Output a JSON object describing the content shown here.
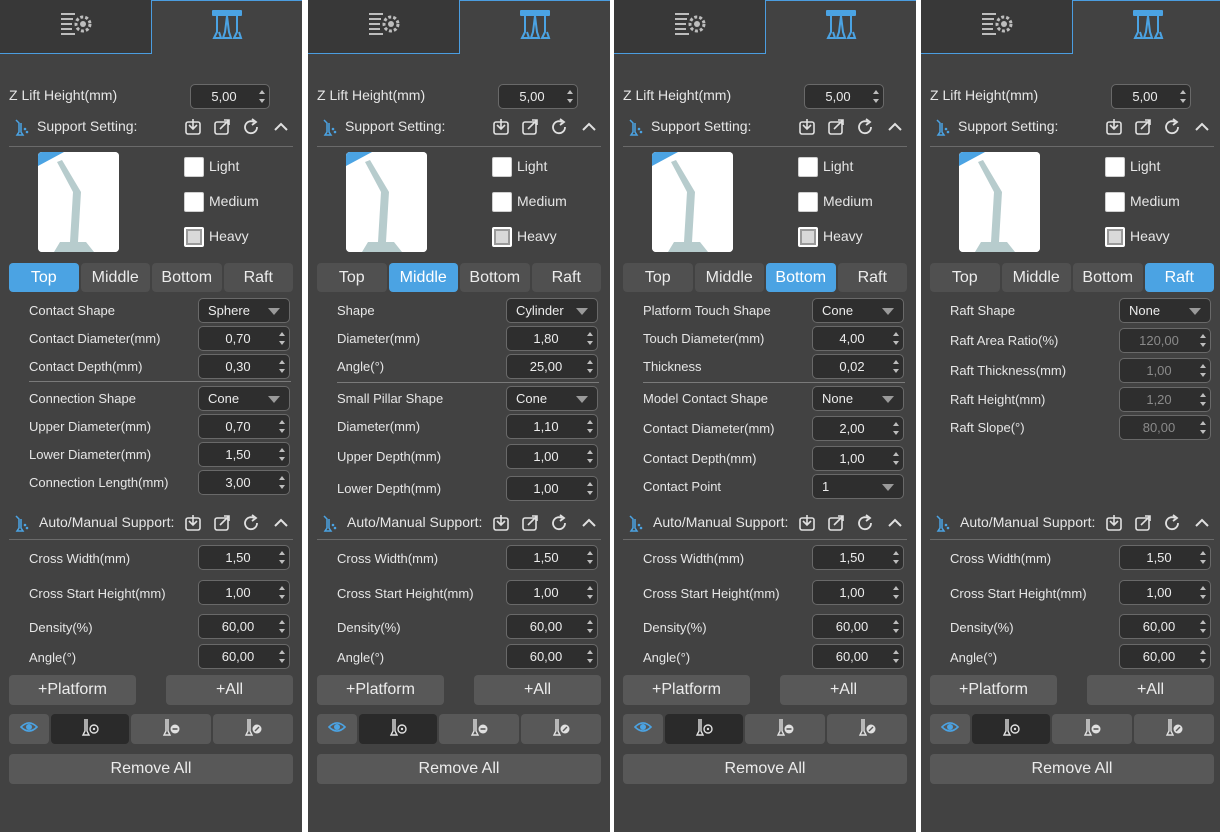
{
  "colors": {
    "accent": "#4ba3e3",
    "panel_bg": "#424242",
    "field_bg": "#2e2e2e"
  },
  "icons": {
    "tab_settings": "list-gear-icon",
    "tab_support": "support-pillars-icon",
    "section": "support-small-icon",
    "import": "import-icon",
    "export": "export-icon",
    "reset": "refresh-icon",
    "collapse": "chevron-up-icon",
    "eye": "eye-icon",
    "add_point": "support-add-icon",
    "remove_point": "support-remove-icon",
    "edit_point": "support-edit-icon"
  },
  "common": {
    "z_lift_label": "Z Lift Height(mm)",
    "z_lift_value": "5,00",
    "support_setting_label": "Support Setting:",
    "presets": [
      "Light",
      "Medium",
      "Heavy"
    ],
    "selected_preset": "Heavy",
    "tabs": [
      "Top",
      "Middle",
      "Bottom",
      "Raft"
    ],
    "auto_manual_label": "Auto/Manual Support:",
    "auto_fields": [
      {
        "label": "Cross Width(mm)",
        "value": "1,50"
      },
      {
        "label": "Cross Start Height(mm)",
        "value": "1,00"
      },
      {
        "label": "Density(%)",
        "value": "60,00"
      },
      {
        "label": "Angle(°)",
        "value": "60,00"
      }
    ],
    "platform_btn": "+Platform",
    "all_btn": "+All",
    "remove_all_btn": "Remove All"
  },
  "panels": [
    {
      "active_tab": "Top",
      "fields": [
        {
          "label": "Contact Shape",
          "type": "select",
          "value": "Sphere"
        },
        {
          "label": "Contact Diameter(mm)",
          "type": "spin",
          "value": "0,70"
        },
        {
          "label": "Contact Depth(mm)",
          "type": "spin",
          "value": "0,30",
          "sep_after": true
        },
        {
          "label": "Connection Shape",
          "type": "select",
          "value": "Cone"
        },
        {
          "label": "Upper Diameter(mm)",
          "type": "spin",
          "value": "0,70"
        },
        {
          "label": "Lower Diameter(mm)",
          "type": "spin",
          "value": "1,50"
        },
        {
          "label": "Connection Length(mm)",
          "type": "spin",
          "value": "3,00"
        }
      ]
    },
    {
      "active_tab": "Middle",
      "fields": [
        {
          "label": "Shape",
          "type": "select",
          "value": "Cylinder"
        },
        {
          "label": "Diameter(mm)",
          "type": "spin",
          "value": "1,80"
        },
        {
          "label": "Angle(°)",
          "type": "spin",
          "value": "25,00",
          "sep_after": true
        },
        {
          "label": "Small Pillar Shape",
          "type": "select",
          "value": "Cone"
        },
        {
          "label": "Diameter(mm)",
          "type": "spin",
          "value": "1,10"
        },
        {
          "label": "Upper Depth(mm)",
          "type": "spin",
          "value": "1,00"
        },
        {
          "label": "Lower Depth(mm)",
          "type": "spin",
          "value": "1,00"
        }
      ]
    },
    {
      "active_tab": "Bottom",
      "fields": [
        {
          "label": "Platform Touch Shape",
          "type": "select",
          "value": "Cone"
        },
        {
          "label": "Touch Diameter(mm)",
          "type": "spin",
          "value": "4,00"
        },
        {
          "label": "Thickness",
          "type": "spin",
          "value": "0,02",
          "sep_after": true
        },
        {
          "label": "Model Contact Shape",
          "type": "select",
          "value": "None"
        },
        {
          "label": "Contact Diameter(mm)",
          "type": "spin",
          "value": "2,00"
        },
        {
          "label": "Contact Depth(mm)",
          "type": "spin",
          "value": "1,00"
        },
        {
          "label": "Contact Point",
          "type": "select",
          "value": "1"
        }
      ]
    },
    {
      "active_tab": "Raft",
      "fields": [
        {
          "label": "Raft Shape",
          "type": "select",
          "value": "None"
        },
        {
          "label": "Raft Area Ratio(%)",
          "type": "spin",
          "value": "120,00",
          "disabled": true
        },
        {
          "label": "Raft Thickness(mm)",
          "type": "spin",
          "value": "1,00",
          "disabled": true
        },
        {
          "label": "Raft Height(mm)",
          "type": "spin",
          "value": "1,20",
          "disabled": true
        },
        {
          "label": "Raft Slope(°)",
          "type": "spin",
          "value": "80,00",
          "disabled": true
        }
      ]
    }
  ]
}
